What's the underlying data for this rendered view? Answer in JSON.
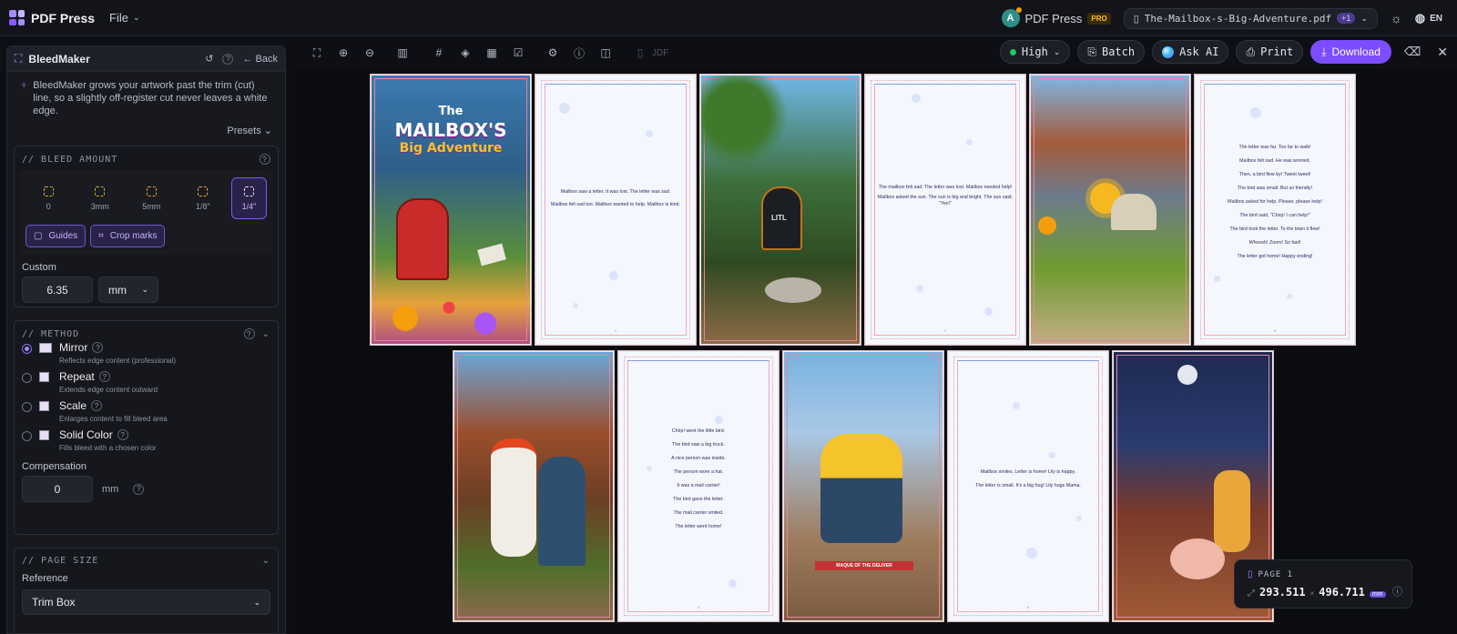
{
  "app": {
    "name": "PDF Press",
    "file_menu": "File"
  },
  "account": {
    "avatar": "A",
    "name": "PDF Press",
    "badge": "PRO"
  },
  "document": {
    "filename": "The-Mailbox-s-Big-Adventure.pdf",
    "extra": "+1"
  },
  "language": "EN",
  "panel": {
    "title": "BleedMaker",
    "back": "Back",
    "tip": "BleedMaker grows your artwork past the trim (cut) line, so a slightly off-register cut never leaves a white edge.",
    "presets": "Presets",
    "bleed": {
      "header": "// BLEED AMOUNT",
      "options": [
        "0",
        "3mm",
        "5mm",
        "1/8\"",
        "1/4\""
      ],
      "selected": "1/4\"",
      "guides": "Guides",
      "crop_marks": "Crop marks",
      "custom_label": "Custom",
      "custom_value": "6.35",
      "unit": "mm"
    },
    "method": {
      "header": "// METHOD",
      "options": [
        {
          "name": "Mirror",
          "desc": "Reflects edge content (professional)",
          "selected": true
        },
        {
          "name": "Repeat",
          "desc": "Extends edge content outward",
          "selected": false
        },
        {
          "name": "Scale",
          "desc": "Enlarges content to fill bleed area",
          "selected": false
        },
        {
          "name": "Solid Color",
          "desc": "Fills bleed with a chosen color",
          "selected": false
        }
      ],
      "compensation_label": "Compensation",
      "compensation_value": "0",
      "compensation_unit": "mm"
    },
    "page_size": {
      "header": "// PAGE SIZE",
      "reference_label": "Reference",
      "reference_value": "Trim Box"
    }
  },
  "toolbar": {
    "jdf": "JDF",
    "quality": "High",
    "batch": "Batch",
    "ask_ai": "Ask AI",
    "print": "Print",
    "download": "Download"
  },
  "pages": {
    "cover": {
      "line1": "The",
      "line2": "MAILBOX'S",
      "line3": "Big Adventure"
    },
    "p2": [
      "Mailbox saw a letter. It was lost. The letter was sad.",
      "Mailbox felt sad too. Mailbox wanted to help. Mailbox is kind."
    ],
    "p3_sign": "LITL",
    "p4": [
      "The mailbox felt sad. The letter was lost. Mailbox needed help!",
      "Mailbox asked the sun. The sun is big and bright. The sun said, \"Yes!\""
    ],
    "p6": [
      "The letter was far. Too far to walk!",
      "Mailbox felt sad. He was worried.",
      "Then, a bird flew by! Tweet tweet!",
      "The bird was small. But so friendly!",
      "Mailbox asked for help. Please, please help!",
      "The bird said, \"Chirp! I can help!\"",
      "The bird took the letter. To the town it flew!",
      "Whoosh! Zoom! So fast!",
      "The letter got home! Happy ending!"
    ],
    "p8": [
      "Chirp! went the little bird.",
      "The bird saw a big truck.",
      "A nice person was inside.",
      "The person wore a hat.",
      "It was a mail carrier!",
      "The bird gave the letter.",
      "The mail carrier smiled.",
      "The letter went home!"
    ],
    "p9_sign": "MAQUE OF THE DELIVER",
    "p10": [
      "Mailbox smiles. Letter is home! Lily is happy.",
      "The letter is small. It's a big hug! Lily hugs Mama."
    ],
    "num1": "1",
    "num2": "2",
    "num3": "3",
    "num4": "4",
    "num5": "5"
  },
  "page_info": {
    "label": "PAGE 1",
    "width": "293.511",
    "x": "×",
    "height": "496.711",
    "unit": "mm"
  }
}
